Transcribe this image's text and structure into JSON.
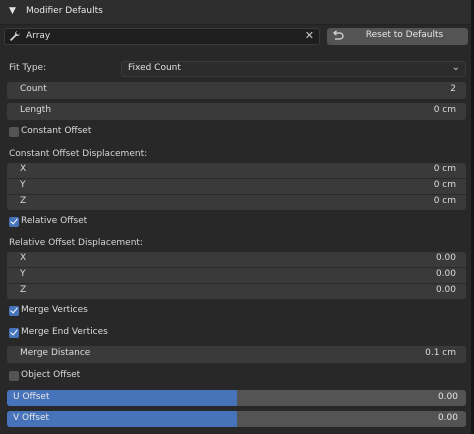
{
  "panel": {
    "header_title": "Modifier Defaults",
    "expand_icon": "triangle-down-icon"
  },
  "modifier": {
    "name": "Array",
    "icon": "wrench-icon",
    "clear_icon": "close-icon"
  },
  "reset_button": {
    "label": "Reset to Defaults",
    "icon": "reset-icon"
  },
  "fit_type": {
    "label": "Fit Type:",
    "value": "Fixed Count"
  },
  "count": {
    "label": "Count",
    "value": "2"
  },
  "length": {
    "label": "Length",
    "value": "0 cm"
  },
  "constant_offset": {
    "label": "Constant Offset",
    "checked": false
  },
  "constant_displacement": {
    "label": "Constant Offset Displacement:",
    "rows": [
      {
        "label": "X",
        "value": "0 cm"
      },
      {
        "label": "Y",
        "value": "0 cm"
      },
      {
        "label": "Z",
        "value": "0 cm"
      }
    ]
  },
  "relative_offset": {
    "label": "Relative Offset",
    "checked": true
  },
  "relative_displacement": {
    "label": "Relative Offset Displacement:",
    "rows": [
      {
        "label": "X",
        "value": "0.00"
      },
      {
        "label": "Y",
        "value": "0.00"
      },
      {
        "label": "Z",
        "value": "0.00"
      }
    ]
  },
  "merge_vertices": {
    "label": "Merge Vertices",
    "checked": true
  },
  "merge_end_vertices": {
    "label": "Merge End Vertices",
    "checked": true
  },
  "merge_distance": {
    "label": "Merge Distance",
    "value": "0.1 cm"
  },
  "object_offset": {
    "label": "Object Offset",
    "checked": false
  },
  "u_offset": {
    "label": "U Offset",
    "value": "0.00",
    "fill_fraction": 0.5
  },
  "v_offset": {
    "label": "V Offset",
    "value": "0.00",
    "fill_fraction": 0.5
  },
  "colors": {
    "accent": "#4773bb",
    "background": "#282828",
    "field": "#3a3a3a",
    "button": "#545454"
  }
}
